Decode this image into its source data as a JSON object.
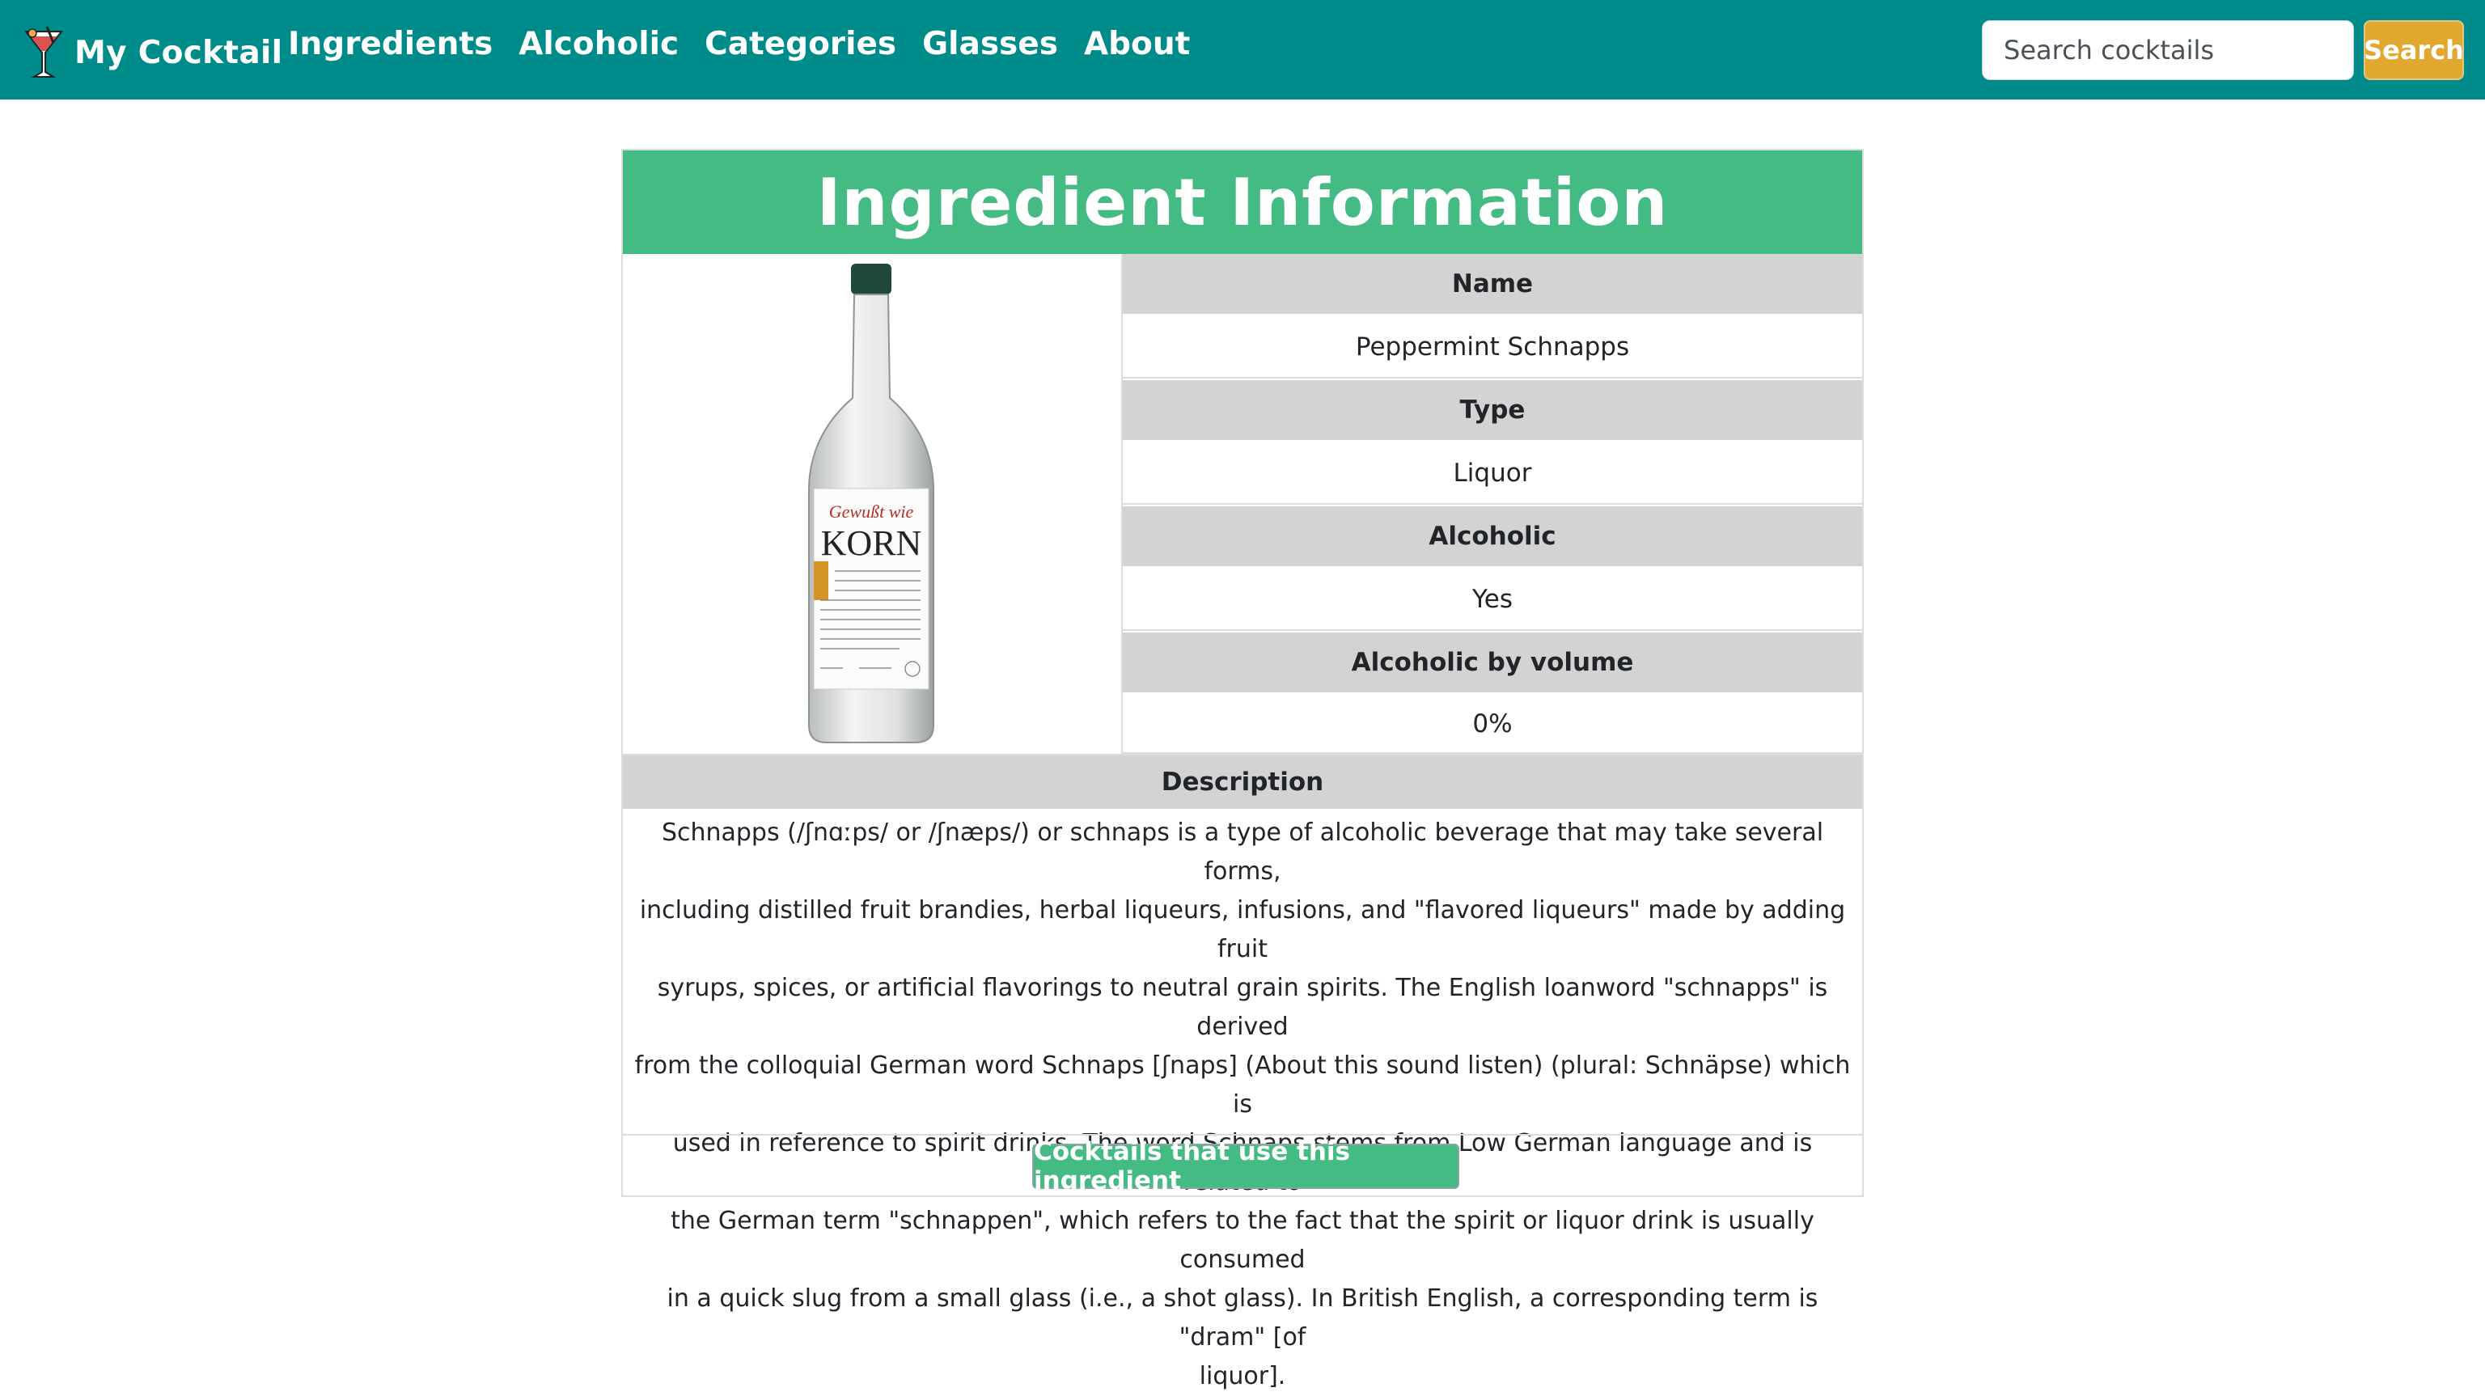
{
  "navbar": {
    "brand": "My Cocktail",
    "brand_icon": "cocktail-glass-icon",
    "links": [
      "Ingredients",
      "Alcoholic",
      "Categories",
      "Glasses",
      "About"
    ],
    "search_placeholder": "Search cocktails",
    "search_button": "Search",
    "background": "#008b8b",
    "search_button_color": "#e0a82e"
  },
  "card": {
    "title": "Ingredient Information",
    "title_color": "#45bb84",
    "image_label": {
      "brand": "Gewußt wie",
      "name": "KORN"
    },
    "fields": [
      {
        "label": "Name",
        "value": "Peppermint Schnapps"
      },
      {
        "label": "Type",
        "value": "Liquor"
      },
      {
        "label": "Alcoholic",
        "value": "Yes"
      },
      {
        "label": "Alcoholic by volume",
        "value": "0%"
      }
    ],
    "description_label": "Description",
    "description_lines": [
      "Schnapps (/ʃnɑːps/ or /ʃnæps/) or schnaps is a type of alcoholic beverage that may take several forms,",
      "including distilled fruit brandies, herbal liqueurs, infusions, and \"flavored liqueurs\" made by adding fruit",
      "syrups, spices, or artificial flavorings to neutral grain spirits. The English loanword \"schnapps\" is derived",
      "from the colloquial German word Schnaps [ʃnaps] (About this sound listen) (plural: Schnäpse) which is",
      "used in reference to spirit drinks. The word Schnaps stems from Low German language and is related to",
      "the German term \"schnappen\", which refers to the fact that the spirit or liquor drink is usually consumed",
      "in a quick slug from a small glass (i.e., a shot glass). In British English, a corresponding term is \"dram\" [of",
      "liquor]."
    ],
    "action_button": "Cocktails that use this ingredient"
  }
}
